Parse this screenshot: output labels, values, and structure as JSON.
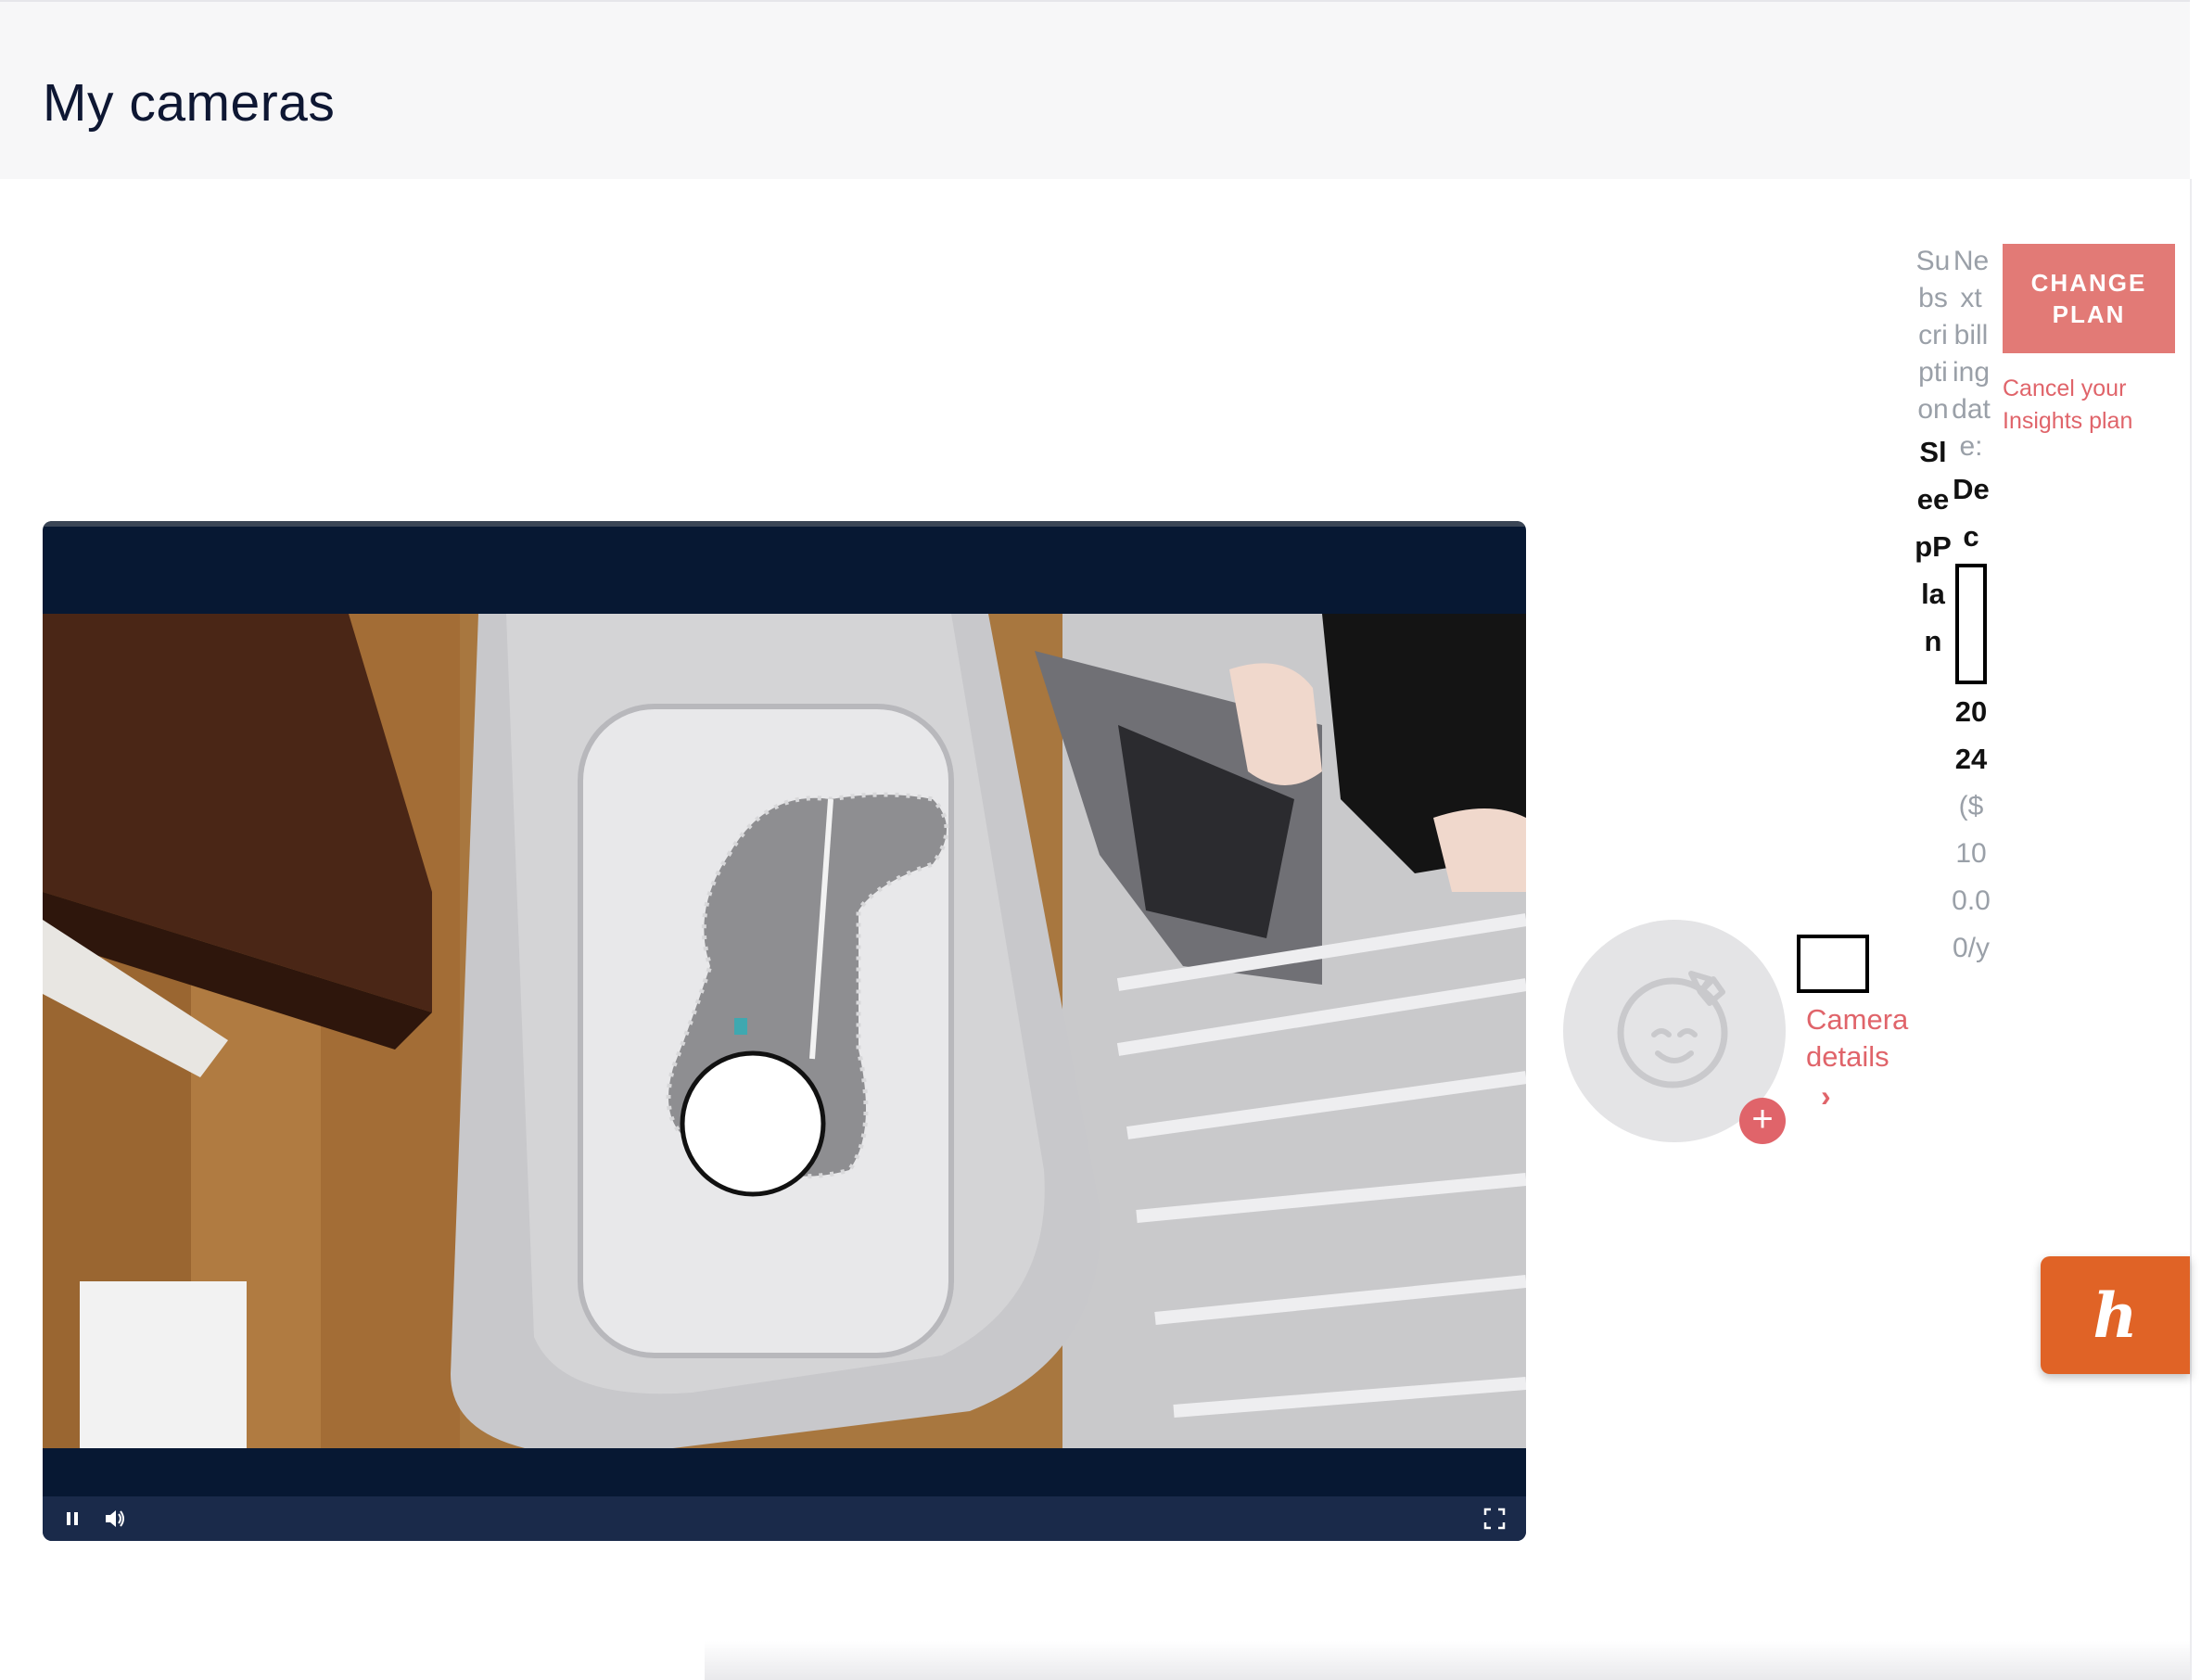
{
  "page": {
    "title": "My cameras"
  },
  "player": {
    "play_pause_icon": "pause-icon",
    "volume_icon": "volume-icon",
    "fullscreen_icon": "fullscreen-icon"
  },
  "camera": {
    "avatar_icon": "baby-face-icon",
    "add_icon": "plus-icon",
    "add_symbol": "+",
    "details_label": "Camera details",
    "details_chevron": "›"
  },
  "subscription": {
    "label": "Subscription",
    "plan": "SleepPlan",
    "next_billing_label": "Next billing date:",
    "next_billing_month": "Dec",
    "next_billing_year": "2024",
    "price": "($100.00/y"
  },
  "actions": {
    "change_plan": "CHANGE PLAN",
    "cancel_link": "Cancel your Insights plan"
  },
  "extension": {
    "logo_letter": "h",
    "name_icon": "honey-extension-icon"
  },
  "colors": {
    "accent": "#e0646a",
    "navy": "#071833",
    "honey": "#e06326"
  }
}
